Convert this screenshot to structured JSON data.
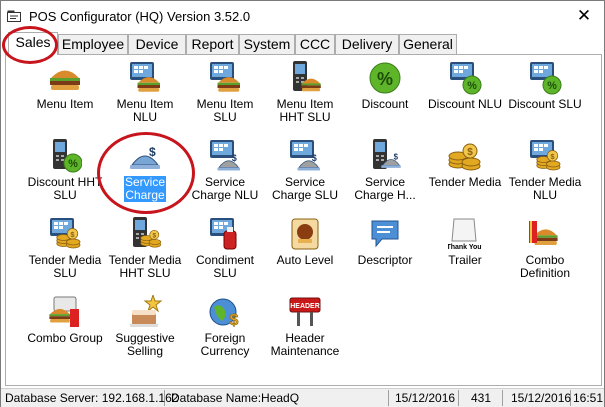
{
  "window": {
    "title": "POS Configurator (HQ) Version 3.52.0",
    "close_glyph": "✕"
  },
  "tabs": [
    {
      "label": "Sales",
      "active": true
    },
    {
      "label": "Employee",
      "active": false
    },
    {
      "label": "Device",
      "active": false
    },
    {
      "label": "Report",
      "active": false
    },
    {
      "label": "System",
      "active": false
    },
    {
      "label": "CCC",
      "active": false
    },
    {
      "label": "Delivery",
      "active": false
    },
    {
      "label": "General",
      "active": false
    }
  ],
  "items": [
    {
      "line1": "Menu Item",
      "line2": "",
      "icon": "burger-icon"
    },
    {
      "line1": "Menu Item",
      "line2": "NLU",
      "icon": "burger-screen-icon"
    },
    {
      "line1": "Menu Item",
      "line2": "SLU",
      "icon": "burger-screen-icon"
    },
    {
      "line1": "Menu Item",
      "line2": "HHT SLU",
      "icon": "burger-handheld-icon"
    },
    {
      "line1": "Discount",
      "line2": "",
      "icon": "discount-icon"
    },
    {
      "line1": "Discount NLU",
      "line2": "",
      "icon": "discount-screen-icon"
    },
    {
      "line1": "Discount SLU",
      "line2": "",
      "icon": "discount-screen-icon"
    },
    {
      "line1": "Discount HHT",
      "line2": "SLU",
      "icon": "discount-handheld-icon"
    },
    {
      "line1": "Service",
      "line2": "Charge",
      "icon": "service-charge-icon",
      "selected": true
    },
    {
      "line1": "Service",
      "line2": "Charge NLU",
      "icon": "service-charge-screen-icon"
    },
    {
      "line1": "Service",
      "line2": "Charge SLU",
      "icon": "service-charge-screen-icon"
    },
    {
      "line1": "Service",
      "line2": "Charge H...",
      "icon": "service-charge-handheld-icon"
    },
    {
      "line1": "Tender Media",
      "line2": "",
      "icon": "coins-icon"
    },
    {
      "line1": "Tender Media",
      "line2": "NLU",
      "icon": "coins-screen-icon"
    },
    {
      "line1": "Tender Media",
      "line2": "SLU",
      "icon": "coins-screen-icon"
    },
    {
      "line1": "Tender Media",
      "line2": "HHT SLU",
      "icon": "coins-handheld-icon"
    },
    {
      "line1": "Condiment",
      "line2": "SLU",
      "icon": "condiment-icon"
    },
    {
      "line1": "Auto Level",
      "line2": "",
      "icon": "auto-level-icon"
    },
    {
      "line1": "Descriptor",
      "line2": "",
      "icon": "descriptor-icon"
    },
    {
      "line1": "Trailer",
      "line2": "",
      "icon": "thank-you-receipt-icon"
    },
    {
      "line1": "Combo",
      "line2": "Definition",
      "icon": "combo-meal-icon"
    },
    {
      "line1": "Combo Group",
      "line2": "",
      "icon": "combo-group-icon"
    },
    {
      "line1": "Suggestive",
      "line2": "Selling",
      "icon": "cake-icon"
    },
    {
      "line1": "Foreign",
      "line2": "Currency",
      "icon": "globe-dollar-icon"
    },
    {
      "line1": "Header",
      "line2": "Maintenance",
      "icon": "header-sign-icon"
    }
  ],
  "icon_text": {
    "thank_you": "Thank You",
    "header": "HEADER",
    "dollar": "$",
    "percent": "%"
  },
  "statusbar": {
    "server": "Database Server: 192.168.1.162",
    "dbname": "Database Name:HeadQ",
    "date1": "15/12/2016",
    "count": "431",
    "date2": "15/12/2016",
    "time": "16:51"
  },
  "colors": {
    "selection": "#3399ff",
    "highlight_circle": "#c8141c",
    "discount_green": "#5fb52a",
    "coin_gold": "#e2a822"
  }
}
